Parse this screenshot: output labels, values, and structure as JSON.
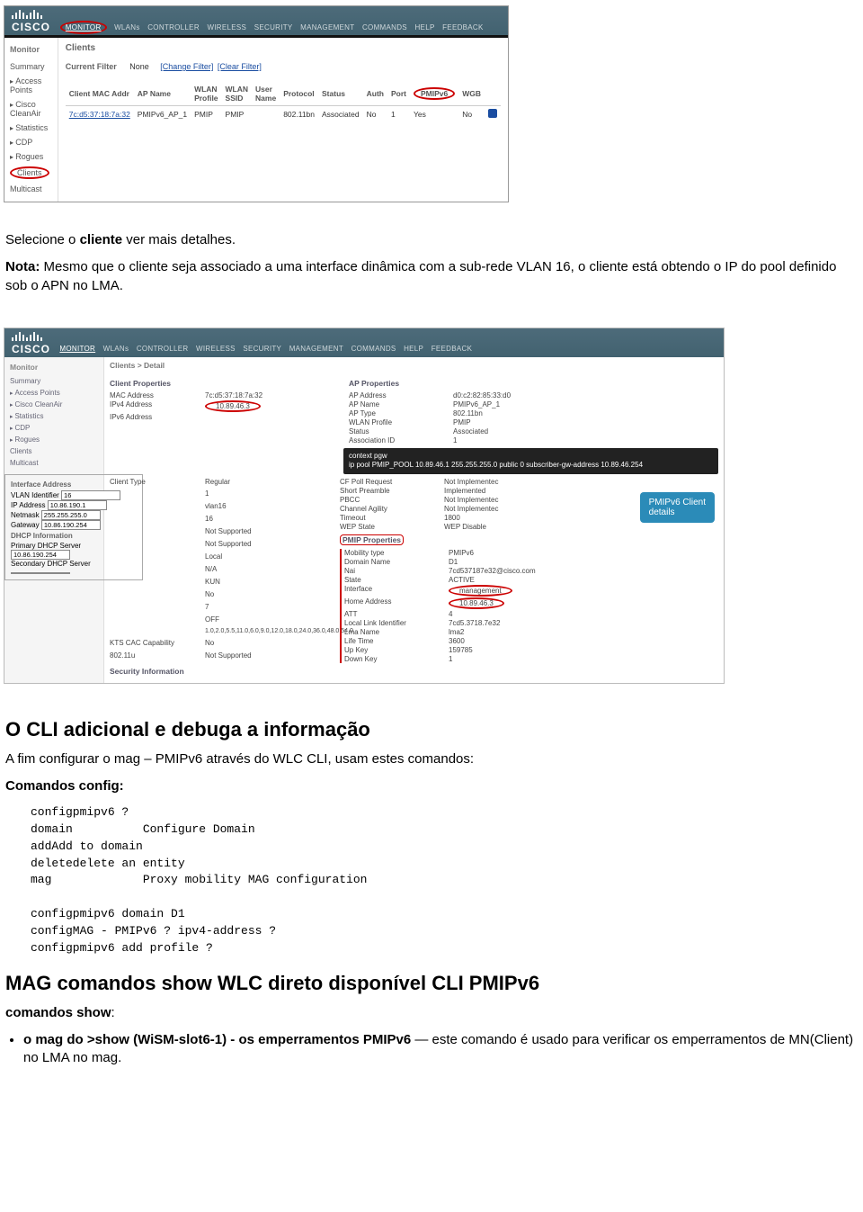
{
  "shot1": {
    "brand": "CISCO",
    "tabs": [
      "MONITOR",
      "WLANs",
      "CONTROLLER",
      "WIRELESS",
      "SECURITY",
      "MANAGEMENT",
      "COMMANDS",
      "HELP",
      "FEEDBACK"
    ],
    "active_tab": "MONITOR",
    "sidebar_header": "Monitor",
    "sidebar_items": [
      "Summary",
      "Access Points",
      "Cisco CleanAir",
      "Statistics",
      "CDP",
      "Rogues",
      "Clients",
      "Multicast"
    ],
    "circled_sidebar": "Clients",
    "page_title": "Clients",
    "filter_label": "Current Filter",
    "filter_value": "None",
    "filter_link1": "[Change Filter]",
    "filter_link2": "[Clear Filter]",
    "columns": [
      "Client MAC Addr",
      "AP Name",
      "WLAN Profile",
      "WLAN SSID",
      "User Name",
      "Protocol",
      "Status",
      "Auth",
      "Port",
      "PMIPv6",
      "WGB"
    ],
    "circled_col": "PMIPv6",
    "row": {
      "mac": "7c:d5:37:18:7a:32",
      "ap": "PMIPv6_AP_1",
      "profile": "PMIP",
      "ssid": "PMIP",
      "user": "",
      "protocol": "802.11bn",
      "status": "Associated",
      "auth": "No",
      "port": "1",
      "pmipv6": "Yes",
      "wgb": "No"
    }
  },
  "text1": {
    "p1a": "Selecione o ",
    "p1b": "cliente",
    "p1c": " ver mais detalhes.",
    "p2a": "Nota: ",
    "p2b": "Mesmo que o cliente seja associado a uma interface dinâmica com a sub-rede VLAN 16, o cliente está obtendo o IP do pool definido sob o APN no LMA."
  },
  "shot2": {
    "brand": "CISCO",
    "tabs": [
      "MONITOR",
      "WLANs",
      "CONTROLLER",
      "WIRELESS",
      "SECURITY",
      "MANAGEMENT",
      "COMMANDS",
      "HELP",
      "FEEDBACK"
    ],
    "sidebar_header": "Monitor",
    "sidebar_items": [
      "Summary",
      "Access Points",
      "Cisco CleanAir",
      "Statistics",
      "CDP",
      "Rogues",
      "Clients",
      "Multicast"
    ],
    "page_title": "Clients > Detail",
    "sec1": "Client Properties",
    "sec2": "AP Properties",
    "client_props": [
      [
        "MAC Address",
        "7c:d5:37:18:7a:32"
      ],
      [
        "IPv4 Address",
        "10.89.46.3"
      ],
      [
        "IPv6 Address",
        ""
      ]
    ],
    "ap_props": [
      [
        "AP Address",
        "d0:c2:82:85:33:d0"
      ],
      [
        "AP Name",
        "PMIPv6_AP_1"
      ],
      [
        "AP Type",
        "802.11bn"
      ],
      [
        "WLAN Profile",
        "PMIP"
      ],
      [
        "Status",
        "Associated"
      ],
      [
        "Association ID",
        "1"
      ]
    ],
    "darkbox_l1": "context pgw",
    "darkbox_l2": "ip pool PMIP_POOL 10.89.46.1 255.255.255.0 public 0 subscriber-gw-address 10.89.46.254",
    "mid_left": [
      [
        "Client Type",
        "Regular"
      ],
      [
        "",
        "1"
      ],
      [
        "",
        "vlan16"
      ],
      [
        "",
        "16"
      ],
      [
        "",
        "Not Supported"
      ],
      [
        "",
        "Not Supported"
      ],
      [
        "",
        "Local"
      ],
      [
        "",
        "N/A"
      ],
      [
        "",
        "KUN"
      ],
      [
        "",
        "No"
      ],
      [
        "",
        "7"
      ],
      [
        "",
        "OFF"
      ],
      [
        "",
        "1.0,2.0,5.5,11.0,6.0,9.0,12.0,18.0,24.0,36.0,48.0,54.0"
      ],
      [
        "KTS CAC Capability",
        "No"
      ],
      [
        "802.11u",
        "Not Supported"
      ]
    ],
    "mid_right_a": [
      [
        "CF Poll Request",
        "Not Implementec"
      ],
      [
        "Short Preamble",
        "Implemented"
      ],
      [
        "PBCC",
        "Not Implementec"
      ],
      [
        "Channel Agility",
        "Not Implementec"
      ],
      [
        "Timeout",
        "1800"
      ],
      [
        "WEP State",
        "WEP Disable"
      ]
    ],
    "sec3": "PMIP Properties",
    "pmip_props": [
      [
        "Mobility type",
        "PMIPv6"
      ],
      [
        "Domain Name",
        "D1"
      ],
      [
        "Nai",
        "7cd537187e32@cisco.com"
      ],
      [
        "State",
        "ACTIVE"
      ],
      [
        "Interface",
        "management"
      ],
      [
        "Home Address",
        "10.89.46.3"
      ],
      [
        "ATT",
        "4"
      ],
      [
        "Local Link Identifier",
        "7cd5.3718.7e32"
      ],
      [
        "Lma Name",
        "lma2"
      ],
      [
        "Life Time",
        "3600"
      ],
      [
        "Up Key",
        "159785"
      ],
      [
        "Down Key",
        "1"
      ]
    ],
    "sec4": "Security Information",
    "callout_l1": "PMIPv6 Client",
    "callout_l2": "details",
    "sidepanel": {
      "hdr": "Interface Address",
      "rows": [
        [
          "VLAN Identifier",
          "16"
        ],
        [
          "IP Address",
          "10.86.190.1"
        ],
        [
          "Netmask",
          "255.255.255.0"
        ],
        [
          "Gateway",
          "10.86.190.254"
        ]
      ],
      "hdr2": "DHCP Information",
      "rows2": [
        [
          "Primary DHCP Server",
          "10.86.190.254"
        ],
        [
          "Secondary DHCP Server",
          ""
        ]
      ]
    }
  },
  "text2": {
    "h2": "O CLI adicional e debuga a informação",
    "p1": "A fim configurar o mag – PMIPv6 através do WLC CLI, usam estes comandos:",
    "p2": "Comandos config:",
    "pre": "configpmipv6 ?\ndomain          Configure Domain\naddAdd to domain\ndeletedelete an entity\nmag             Proxy mobility MAG configuration\n\nconfigpmipv6 domain D1\nconfigMAG - PMIPv6 ? ipv4-address ?\nconfigpmipv6 add profile ?",
    "h3": "MAG comandos show WLC direto disponível CLI PMIPv6",
    "p3a": "comandos show",
    "p3b": ":",
    "li1a": "o mag do ",
    "li1b": ">show (WiSM-slot6-1) - os emperramentos PMIPv6",
    "li1c": " — este comando é usado para verificar os emperramentos de MN(Client) no LMA no mag."
  }
}
